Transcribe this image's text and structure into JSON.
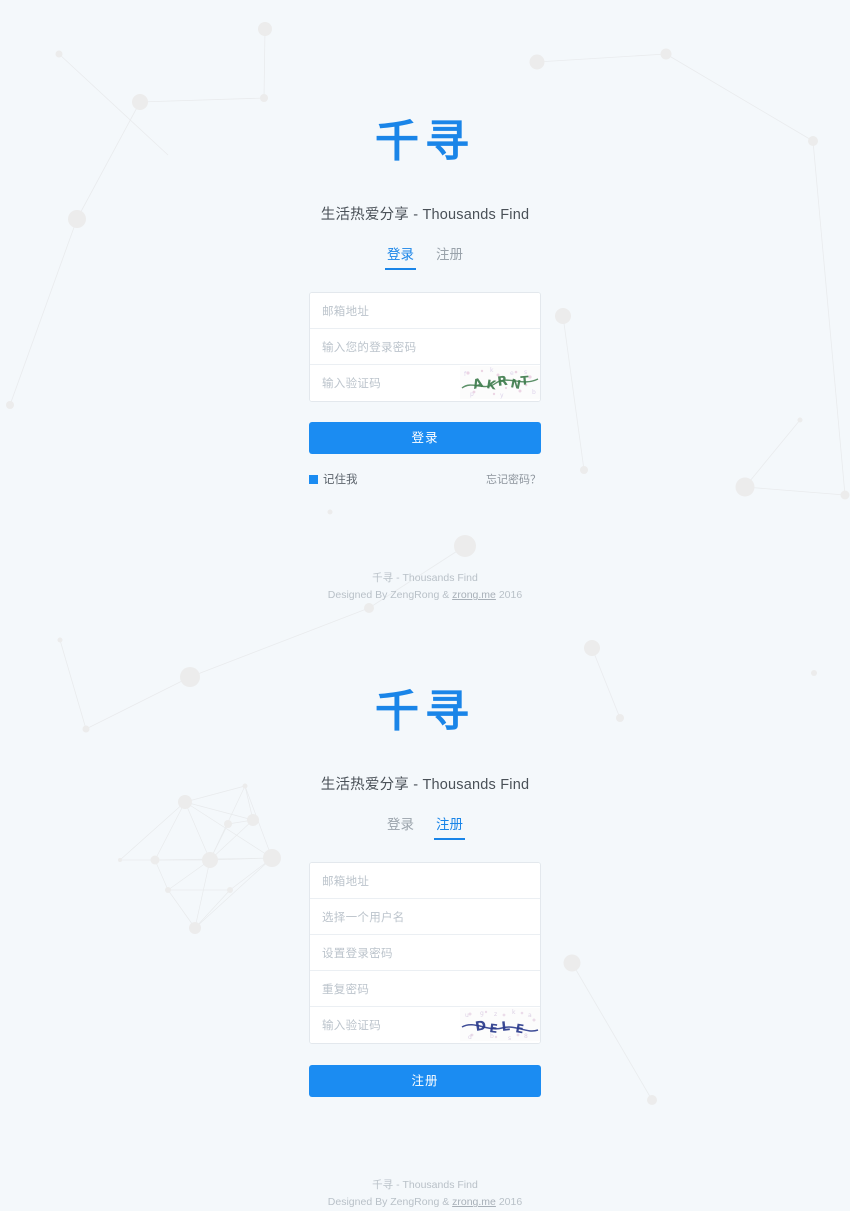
{
  "brand": {
    "logo": "千寻",
    "tagline": "生活热爱分享 - Thousands Find"
  },
  "login_section": {
    "tabs": [
      {
        "label": "登录",
        "active": true
      },
      {
        "label": "注册",
        "active": false
      }
    ],
    "fields": [
      {
        "name": "email",
        "placeholder": "邮箱地址",
        "value": ""
      },
      {
        "name": "password",
        "placeholder": "输入您的登录密码",
        "value": ""
      },
      {
        "name": "captcha",
        "placeholder": "输入验证码",
        "value": ""
      }
    ],
    "captcha": {
      "alt": "captcha-image",
      "text": "AKRNT",
      "color": "#3f7d4e"
    },
    "submit_label": "登录",
    "remember_label": "记住我",
    "remember_checked": true,
    "forgot_label": "忘记密码？"
  },
  "register_section": {
    "tabs": [
      {
        "label": "登录",
        "active": false
      },
      {
        "label": "注册",
        "active": true
      }
    ],
    "fields": [
      {
        "name": "email",
        "placeholder": "邮箱地址",
        "value": ""
      },
      {
        "name": "username",
        "placeholder": "选择一个用户名",
        "value": ""
      },
      {
        "name": "password",
        "placeholder": "设置登录密码",
        "value": ""
      },
      {
        "name": "password-repeat",
        "placeholder": "重复密码",
        "value": ""
      },
      {
        "name": "captcha",
        "placeholder": "输入验证码",
        "value": ""
      }
    ],
    "captcha": {
      "alt": "captcha-image",
      "text": "DELE",
      "color": "#2a3a8c"
    },
    "submit_label": "注册"
  },
  "footer": {
    "line1": "千寻 - Thousands Find",
    "line2_prefix": "Designed By ZengRong & ",
    "link": "zrong.me",
    "line2_suffix": " 2016"
  },
  "colors": {
    "brand_blue": "#1a85e8",
    "button_blue": "#1b8cf2",
    "background": "#f4f8fb",
    "placeholder": "#bcc4cc",
    "footer_text": "#b9c1c8"
  }
}
